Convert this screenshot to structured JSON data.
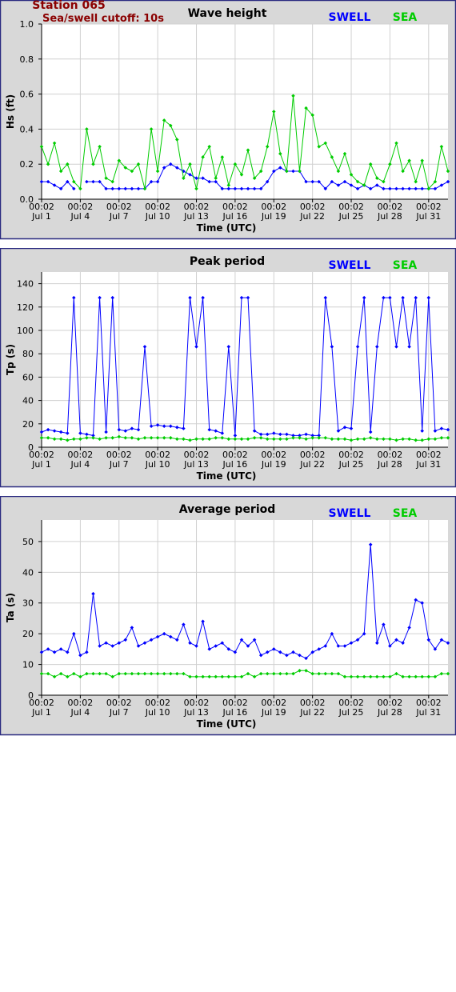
{
  "station": {
    "name": "Station 065",
    "cutoff": "Sea/swell cutoff: 10s"
  },
  "colors": {
    "swell": "#0000ff",
    "sea": "#00cc00",
    "station": "#8b0000",
    "frame_bg": "#d8d8d8",
    "border": "#2a2a80",
    "grid": "#d0d0d0"
  },
  "legend": {
    "swell": "SWELL",
    "sea": "SEA"
  },
  "chart_data": [
    {
      "type": "line",
      "title": "Wave height",
      "xlabel": "Time (UTC)",
      "ylabel": "Hs (ft)",
      "ylim": [
        0,
        1.0
      ],
      "yticks": [
        "0.0",
        "0.2",
        "0.4",
        "0.6",
        "0.8",
        "1.0"
      ],
      "xlim": [
        1.0,
        32.5
      ],
      "xticks": [
        {
          "time": "00:02",
          "date": "Jul 1"
        },
        {
          "time": "00:02",
          "date": "Jul 4"
        },
        {
          "time": "00:02",
          "date": "Jul 7"
        },
        {
          "time": "00:02",
          "date": "Jul 10"
        },
        {
          "time": "00:02",
          "date": "Jul 13"
        },
        {
          "time": "00:02",
          "date": "Jul 16"
        },
        {
          "time": "00:02",
          "date": "Jul 19"
        },
        {
          "time": "00:02",
          "date": "Jul 22"
        },
        {
          "time": "00:02",
          "date": "Jul 25"
        },
        {
          "time": "00:02",
          "date": "Jul 28"
        },
        {
          "time": "00:02",
          "date": "Jul 31"
        }
      ],
      "grid": true,
      "x": [
        1.0,
        1.5,
        2.0,
        2.5,
        3.0,
        3.5,
        4.0,
        4.5,
        5.0,
        5.5,
        6.0,
        6.5,
        7.0,
        7.5,
        8.0,
        8.5,
        9.0,
        9.5,
        10.0,
        10.5,
        11.0,
        11.5,
        12.0,
        12.5,
        13.0,
        13.5,
        14.0,
        14.5,
        15.0,
        15.5,
        16.0,
        16.5,
        17.0,
        17.5,
        18.0,
        18.5,
        19.0,
        19.5,
        20.0,
        20.5,
        21.0,
        21.5,
        22.0,
        22.5,
        23.0,
        23.5,
        24.0,
        24.5,
        25.0,
        25.5,
        26.0,
        26.5,
        27.0,
        27.5,
        28.0,
        28.5,
        29.0,
        29.5,
        30.0,
        30.5,
        31.0,
        31.5,
        32.0,
        32.5
      ],
      "series": [
        {
          "name": "SWELL",
          "values": [
            0.1,
            0.1,
            0.08,
            0.06,
            0.1,
            0.06,
            null,
            0.1,
            0.1,
            0.1,
            0.06,
            0.06,
            0.06,
            0.06,
            0.06,
            0.06,
            0.06,
            0.1,
            0.1,
            0.18,
            0.2,
            0.18,
            0.16,
            0.14,
            0.12,
            0.12,
            0.1,
            0.1,
            0.06,
            0.06,
            0.06,
            0.06,
            0.06,
            0.06,
            0.06,
            0.1,
            0.16,
            0.18,
            0.16,
            0.16,
            0.16,
            0.1,
            0.1,
            0.1,
            0.06,
            0.1,
            0.08,
            0.1,
            0.08,
            0.06,
            0.08,
            0.06,
            0.08,
            0.06,
            0.06,
            0.06,
            0.06,
            0.06,
            0.06,
            0.06,
            0.06,
            0.06,
            0.08,
            0.1
          ]
        },
        {
          "name": "SEA",
          "values": [
            0.3,
            0.2,
            0.32,
            0.16,
            0.2,
            0.1,
            0.06,
            0.4,
            0.2,
            0.3,
            0.12,
            0.1,
            0.22,
            0.18,
            0.16,
            0.2,
            0.06,
            0.4,
            0.16,
            0.45,
            0.42,
            0.34,
            0.12,
            0.2,
            0.06,
            0.24,
            0.3,
            0.12,
            0.24,
            0.08,
            0.2,
            0.14,
            0.28,
            0.12,
            0.16,
            0.3,
            0.5,
            0.26,
            0.16,
            0.59,
            0.16,
            0.52,
            0.48,
            0.3,
            0.32,
            0.24,
            0.16,
            0.26,
            0.14,
            0.1,
            0.08,
            0.2,
            0.12,
            0.1,
            0.2,
            0.32,
            0.16,
            0.22,
            0.1,
            0.22,
            0.06,
            0.1,
            0.3,
            0.16
          ]
        }
      ]
    },
    {
      "type": "line",
      "title": "Peak period",
      "xlabel": "Time (UTC)",
      "ylabel": "Tp (s)",
      "ylim": [
        0,
        150
      ],
      "yticks": [
        "0",
        "20",
        "40",
        "60",
        "80",
        "100",
        "120",
        "140"
      ],
      "xlim": [
        1.0,
        32.5
      ],
      "xticks": [
        {
          "time": "00:02",
          "date": "Jul 1"
        },
        {
          "time": "00:02",
          "date": "Jul 4"
        },
        {
          "time": "00:02",
          "date": "Jul 7"
        },
        {
          "time": "00:02",
          "date": "Jul 10"
        },
        {
          "time": "00:02",
          "date": "Jul 13"
        },
        {
          "time": "00:02",
          "date": "Jul 16"
        },
        {
          "time": "00:02",
          "date": "Jul 19"
        },
        {
          "time": "00:02",
          "date": "Jul 22"
        },
        {
          "time": "00:02",
          "date": "Jul 25"
        },
        {
          "time": "00:02",
          "date": "Jul 28"
        },
        {
          "time": "00:02",
          "date": "Jul 31"
        }
      ],
      "grid": true,
      "x": [
        1.0,
        1.5,
        2.0,
        2.5,
        3.0,
        3.5,
        4.0,
        4.5,
        5.0,
        5.5,
        6.0,
        6.5,
        7.0,
        7.5,
        8.0,
        8.5,
        9.0,
        9.5,
        10.0,
        10.5,
        11.0,
        11.5,
        12.0,
        12.5,
        13.0,
        13.5,
        14.0,
        14.5,
        15.0,
        15.5,
        16.0,
        16.5,
        17.0,
        17.5,
        18.0,
        18.5,
        19.0,
        19.5,
        20.0,
        20.5,
        21.0,
        21.5,
        22.0,
        22.5,
        23.0,
        23.5,
        24.0,
        24.5,
        25.0,
        25.5,
        26.0,
        26.5,
        27.0,
        27.5,
        28.0,
        28.5,
        29.0,
        29.5,
        30.0,
        30.5,
        31.0,
        31.5,
        32.0,
        32.5
      ],
      "series": [
        {
          "name": "SWELL",
          "values": [
            13,
            15,
            14,
            13,
            12,
            128,
            12,
            11,
            10,
            128,
            13,
            128,
            15,
            14,
            16,
            15,
            86,
            18,
            19,
            18,
            18,
            17,
            16,
            128,
            86,
            128,
            15,
            14,
            12,
            86,
            10,
            128,
            128,
            14,
            11,
            11,
            12,
            11,
            11,
            10,
            10,
            11,
            10,
            10,
            128,
            86,
            14,
            17,
            16,
            86,
            128,
            13,
            86,
            128,
            128,
            86,
            128,
            86,
            128,
            14,
            128,
            14,
            16,
            15
          ]
        },
        {
          "name": "SEA",
          "values": [
            8,
            8,
            7,
            7,
            6,
            7,
            7,
            8,
            8,
            7,
            8,
            8,
            9,
            8,
            8,
            7,
            8,
            8,
            8,
            8,
            8,
            7,
            7,
            6,
            7,
            7,
            7,
            8,
            8,
            7,
            7,
            7,
            7,
            8,
            8,
            7,
            7,
            7,
            7,
            8,
            8,
            7,
            8,
            8,
            8,
            7,
            7,
            7,
            6,
            7,
            7,
            8,
            7,
            7,
            7,
            6,
            7,
            7,
            6,
            6,
            7,
            7,
            8,
            8
          ]
        }
      ]
    },
    {
      "type": "line",
      "title": "Average period",
      "xlabel": "Time (UTC)",
      "ylabel": "Ta (s)",
      "ylim": [
        0,
        57
      ],
      "yticks": [
        "0",
        "10",
        "20",
        "30",
        "40",
        "50"
      ],
      "xlim": [
        1.0,
        32.5
      ],
      "xticks": [
        {
          "time": "00:02",
          "date": "Jul 1"
        },
        {
          "time": "00:02",
          "date": "Jul 4"
        },
        {
          "time": "00:02",
          "date": "Jul 7"
        },
        {
          "time": "00:02",
          "date": "Jul 10"
        },
        {
          "time": "00:02",
          "date": "Jul 13"
        },
        {
          "time": "00:02",
          "date": "Jul 16"
        },
        {
          "time": "00:02",
          "date": "Jul 19"
        },
        {
          "time": "00:02",
          "date": "Jul 22"
        },
        {
          "time": "00:02",
          "date": "Jul 25"
        },
        {
          "time": "00:02",
          "date": "Jul 28"
        },
        {
          "time": "00:02",
          "date": "Jul 31"
        }
      ],
      "grid": true,
      "x": [
        1.0,
        1.5,
        2.0,
        2.5,
        3.0,
        3.5,
        4.0,
        4.5,
        5.0,
        5.5,
        6.0,
        6.5,
        7.0,
        7.5,
        8.0,
        8.5,
        9.0,
        9.5,
        10.0,
        10.5,
        11.0,
        11.5,
        12.0,
        12.5,
        13.0,
        13.5,
        14.0,
        14.5,
        15.0,
        15.5,
        16.0,
        16.5,
        17.0,
        17.5,
        18.0,
        18.5,
        19.0,
        19.5,
        20.0,
        20.5,
        21.0,
        21.5,
        22.0,
        22.5,
        23.0,
        23.5,
        24.0,
        24.5,
        25.0,
        25.5,
        26.0,
        26.5,
        27.0,
        27.5,
        28.0,
        28.5,
        29.0,
        29.5,
        30.0,
        30.5,
        31.0,
        31.5,
        32.0,
        32.5
      ],
      "series": [
        {
          "name": "SWELL",
          "values": [
            14,
            15,
            14,
            15,
            14,
            20,
            13,
            14,
            33,
            16,
            17,
            16,
            17,
            18,
            22,
            16,
            17,
            18,
            19,
            20,
            19,
            18,
            23,
            17,
            16,
            24,
            15,
            16,
            17,
            15,
            14,
            18,
            16,
            18,
            13,
            14,
            15,
            14,
            13,
            14,
            13,
            12,
            14,
            15,
            16,
            20,
            16,
            16,
            17,
            18,
            20,
            49,
            17,
            23,
            16,
            18,
            17,
            22,
            31,
            30,
            18,
            15,
            18,
            17
          ]
        },
        {
          "name": "SEA",
          "values": [
            7,
            7,
            6,
            7,
            6,
            7,
            6,
            7,
            7,
            7,
            7,
            6,
            7,
            7,
            7,
            7,
            7,
            7,
            7,
            7,
            7,
            7,
            7,
            6,
            6,
            6,
            6,
            6,
            6,
            6,
            6,
            6,
            7,
            6,
            7,
            7,
            7,
            7,
            7,
            7,
            8,
            8,
            7,
            7,
            7,
            7,
            7,
            6,
            6,
            6,
            6,
            6,
            6,
            6,
            6,
            7,
            6,
            6,
            6,
            6,
            6,
            6,
            7,
            7
          ]
        }
      ]
    }
  ]
}
